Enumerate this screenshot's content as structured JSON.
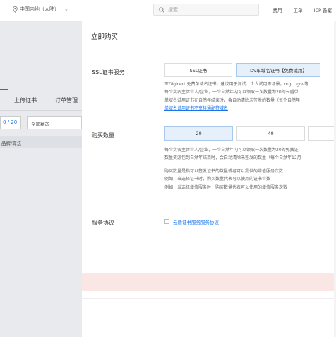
{
  "topbar": {
    "region": "中国内地（大陆）",
    "search_placeholder": "搜索...",
    "links": [
      "费用",
      "工单",
      "ICP 备案"
    ]
  },
  "background_page": {
    "tabs": [
      "上传证书",
      "订单管理"
    ],
    "pager": "0 / 20",
    "status_filter": "全部状态",
    "column_header": "品牌/算法"
  },
  "drawer": {
    "title": "立即购买",
    "ssl": {
      "label": "SSL证书服务",
      "options": [
        {
          "label": "SSL证书",
          "selected": false
        },
        {
          "label": "DV单域名证书【免费试用】",
          "selected": true
        }
      ],
      "desc_lines": [
        {
          "pre": "",
          "link": "",
          "text": "亚Digicert 免费单域名证书，建议用于测试、个人试用等场景。org、.gov等"
        },
        {
          "pre": "",
          "link": "",
          "text": "每个实名主体个人/企业，一个自然年内可以领取一次数量为20的云盾单"
        },
        {
          "pre": "",
          "link": "",
          "text": "单域名试用证书在自然年结束时，会自动清除未签发的数量（每个自然年"
        },
        {
          "pre": "",
          "link": "单域名试用证书不支持通配符域名",
          "text": ""
        }
      ]
    },
    "quantity": {
      "label": "购买数量",
      "options": [
        {
          "label": "20",
          "selected": true
        },
        {
          "label": "40",
          "selected": false
        }
      ],
      "desc_lines": [
        "每个实名主体个人/企业，一个自然年内可以领取一次数量为20的免费证",
        "数量资源包到自然年结束时，会自动清除未签发的数量（每个自然年12月"
      ],
      "notes": [
        "购买数量是指可以签发证书的数量或者可以提供的增值服务次数",
        "例如：当选择证书时，购买数量代表可以使用的证书个数",
        "例如：当选择增值服务时，购买数量代表可以使用的增值服务次数"
      ]
    },
    "agreement": {
      "label": "服务协议",
      "link_text": "云盾证书服务服务协议",
      "checked": false
    }
  }
}
